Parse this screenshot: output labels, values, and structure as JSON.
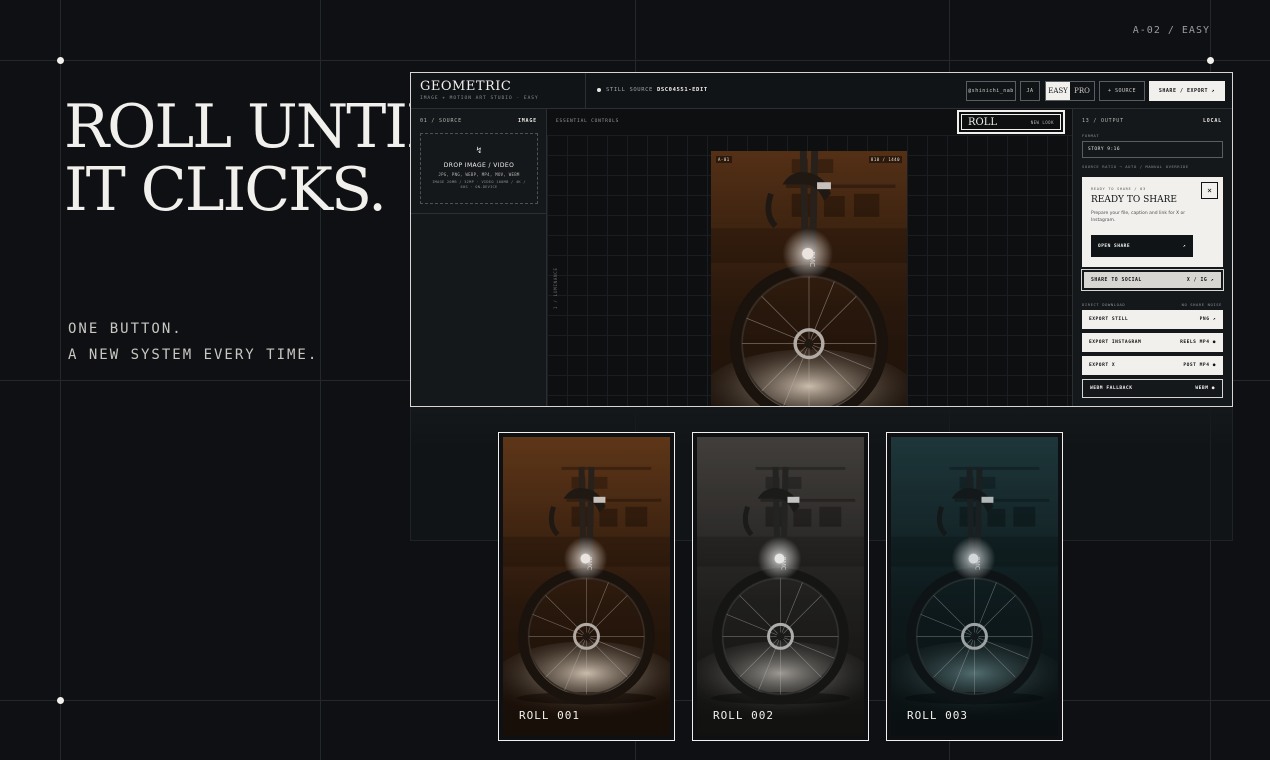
{
  "corner_tag": "A-02 / EASY",
  "headline": [
    "ROLL UNTIL",
    "IT CLICKS."
  ],
  "tagline": [
    "ONE BUTTON.",
    "A NEW SYSTEM EVERY TIME."
  ],
  "app": {
    "brand_name": "GEOMETRIC",
    "brand_sub": "IMAGE + MOTION ART STUDIO · EASY",
    "source_label": "STILL SOURCE",
    "source_file": "DSC04551-EDIT",
    "header": {
      "handle": "@shinichi_nab",
      "lang": "JA",
      "mode_easy": "EASY",
      "mode_pro": "PRO",
      "source_btn": "+ SOURCE",
      "share_btn": "SHARE / EXPORT ↗"
    },
    "left_panel": {
      "title": "01 / SOURCE",
      "mode": "IMAGE",
      "drop_icon": "↯",
      "drop_title": "DROP IMAGE / VIDEO",
      "drop_formats": "JPG, PNG, WEBP, MP4, MOV, WEBM",
      "drop_limits": "IMAGE 20MB / 32MP · VIDEO 100MB / 4K / 60S · ON-DEVICE"
    },
    "center": {
      "label": "ESSENTIAL CONTROLS",
      "roll_label": "ROLL",
      "roll_sub": "NEW LOOK",
      "vertical_label": "1 / LUMINANCE",
      "preview_tag_left": "A-01",
      "preview_tag_right": "810 / 1440"
    },
    "right_panel": {
      "title": "13 / OUTPUT",
      "mode": "LOCAL",
      "format_label": "FORMAT",
      "format_value": "STORY 9:16",
      "ratio_note": "SOURCE RATIO → AUTO / MANUAL OVERRIDE",
      "share_card": {
        "kicker": "READY TO SHARE / 03",
        "title": "READY TO SHARE",
        "desc": "Prepare your file, caption and link for X or Instagram.",
        "open_label": "OPEN SHARE",
        "open_arrow": "↗",
        "close": "×"
      },
      "social_label": "SHARE TO SOCIAL",
      "social_targets": "X / IG ↗",
      "direct_label": "DIRECT DOWNLOAD",
      "direct_note": "NO SHARE NOISE",
      "exports": [
        {
          "label": "EXPORT STILL",
          "value": "PNG ↗"
        },
        {
          "label": "EXPORT INSTAGRAM",
          "value": "REELS MP4 ●"
        },
        {
          "label": "EXPORT X",
          "value": "POST MP4 ●"
        },
        {
          "label": "WEBM FALLBACK",
          "value": "WEBM ●"
        }
      ]
    }
  },
  "rolls": [
    "ROLL 001",
    "ROLL 002",
    "ROLL 003"
  ],
  "colors": {
    "background": "#0e1013",
    "ink": "#f2f0ec",
    "warm_tone": "#6b3d1c",
    "neutral_tone": "#5a5552",
    "cool_tone": "#1e3a3f"
  }
}
